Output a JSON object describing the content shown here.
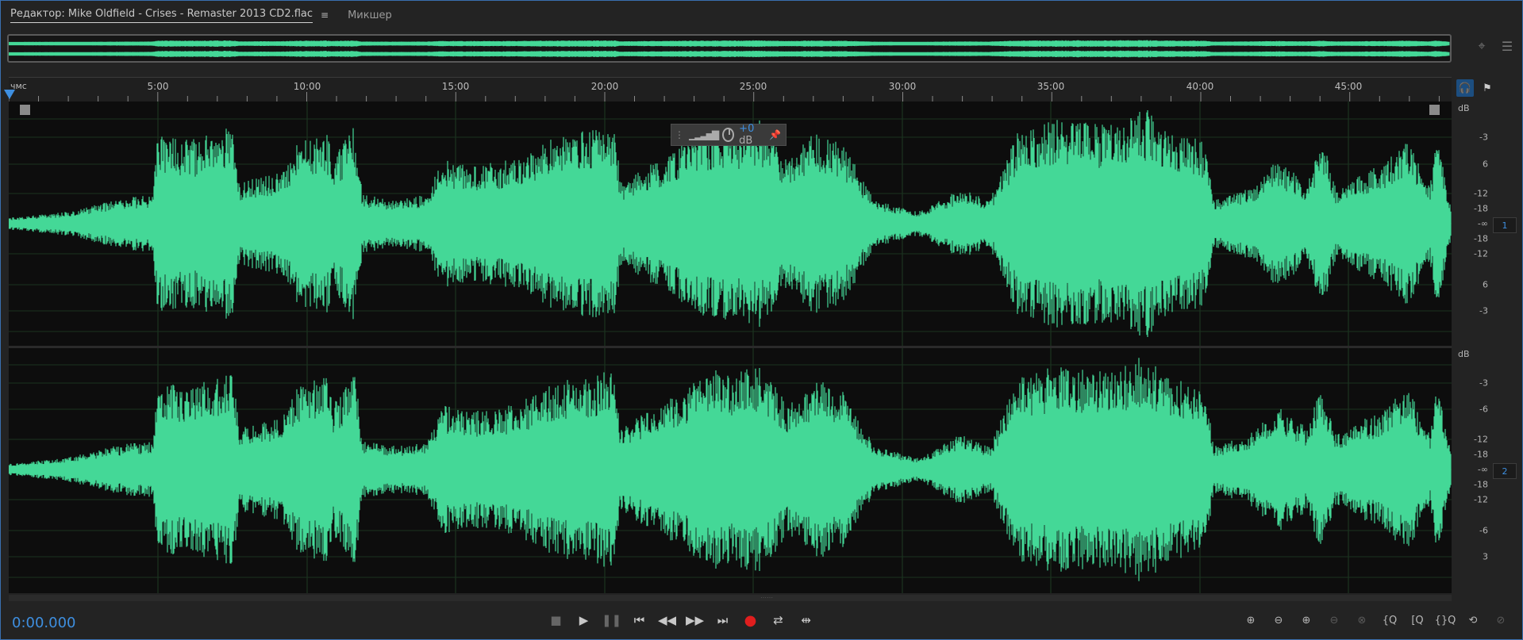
{
  "tabs": {
    "editor": "Редактор: Mike Oldfield - Crises - Remaster 2013 CD2.flac",
    "editor_menu_icon": "hamburger-icon",
    "mixer": "Микшер"
  },
  "ruler": {
    "units": "чмс",
    "ticks": [
      "5:00",
      "10:00",
      "15:00",
      "20:00",
      "25:00",
      "30:00",
      "35:00",
      "40:00",
      "45:00"
    ]
  },
  "hud": {
    "value_prefix": "+0",
    "value_unit": " dB"
  },
  "db_scale": {
    "title": "dB",
    "labels": [
      "-3",
      "6",
      "-12",
      "-18",
      "-∞",
      "-18",
      "-12",
      "6",
      "-3"
    ]
  },
  "db_scale_ch2": {
    "title": "dB",
    "labels": [
      "-3",
      "-6",
      "-12",
      "-18",
      "-∞",
      "-18",
      "-12",
      "-6",
      "3"
    ]
  },
  "channels": [
    "1",
    "2"
  ],
  "time_display": "0:00.000",
  "colors": {
    "waveform": "#44d897",
    "accent": "#3e8fe0",
    "record": "#e01e1e"
  }
}
